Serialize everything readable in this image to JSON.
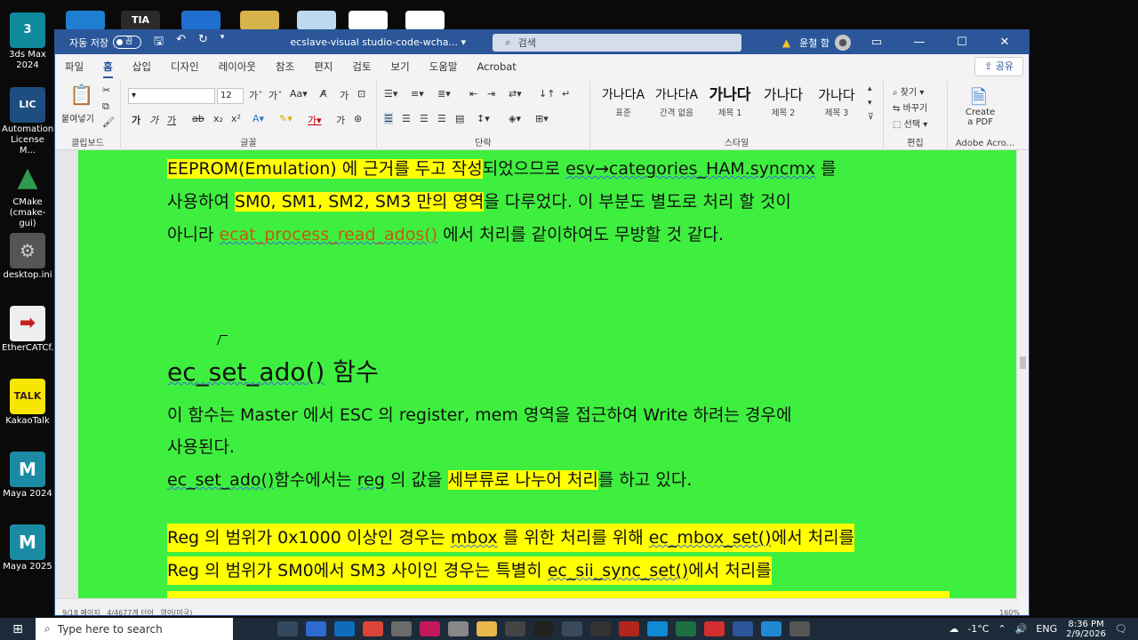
{
  "desktop": {
    "icons": [
      {
        "label": "3ds Max 2024",
        "glyph": "3\nMAX",
        "color": "#0e8a9c"
      },
      {
        "label": "Automation License M...",
        "glyph": "LICEN\nMA",
        "color": "#1e4e80"
      },
      {
        "label": "CMake (cmake-gui)",
        "glyph": "▲",
        "color": "#2f4fa0"
      },
      {
        "label": "desktop.ini",
        "glyph": "⚙",
        "color": "#666666"
      },
      {
        "label": "EtherCATCf...",
        "glyph": "➡",
        "color": "#c62020"
      },
      {
        "label": "KakaoTalk",
        "glyph": "TALK",
        "color": "#f7e600"
      },
      {
        "label": "Maya 2024",
        "glyph": "M",
        "color": "#1a8ba3"
      },
      {
        "label": "Maya 2025",
        "glyph": "M",
        "color": "#1a8ba3"
      }
    ],
    "top_icons": [
      "TIA"
    ]
  },
  "titlebar": {
    "autosave_label": "자동 저장",
    "autosave_state": "끔",
    "doc_name": "ecslave-visual studio-code-wcha...",
    "search_placeholder": "검색",
    "user_name": "윤철 함",
    "minimize": "—",
    "maximize": "☐",
    "close": "✕"
  },
  "tabs": [
    "파일",
    "홈",
    "삽입",
    "디자인",
    "레이아웃",
    "참조",
    "편지",
    "검토",
    "보기",
    "도움말",
    "Acrobat"
  ],
  "active_tab": "홈",
  "share_label": "공유",
  "ribbon": {
    "clipboard": {
      "paste": "붙여넣기",
      "label": "클립보드"
    },
    "font": {
      "size": "12",
      "label": "글꼴",
      "bold": "가",
      "italic": "가",
      "underline": "가"
    },
    "paragraph": {
      "label": "단락"
    },
    "styles": {
      "label": "스타일",
      "items": [
        {
          "sample": "가나다A",
          "name": "표준"
        },
        {
          "sample": "가나다A",
          "name": "간격 없음"
        },
        {
          "sample": "가나다",
          "name": "제목 1"
        },
        {
          "sample": "가나다",
          "name": "제목 2"
        },
        {
          "sample": "가나다",
          "name": "제목 3"
        }
      ]
    },
    "editing": {
      "find": "찾기",
      "replace": "바꾸기",
      "select": "선택",
      "label": "편집"
    },
    "adobe": {
      "create_pdf_1": "Create",
      "create_pdf_2": "a PDF",
      "label": "Adobe Acro..."
    }
  },
  "document": {
    "line1_a": "EEPROM(Emulation) 에 근거를 두고 작성",
    "line1_b": "되었으므로 ",
    "line1_c": "esv→categories_HAM.syncmx",
    "line1_d": " 를",
    "line2_a": "사용하여  ",
    "line2_b": "SM0, SM1, SM2, SM3 만의 영역",
    "line2_c": "을 다루었다.  이 부분도 별도로 처리 할 것이",
    "line3_a": "아니라 ",
    "line3_b": "ecat_process_read_ados()",
    "line3_c": " 에서 처리를 같이하여도 무방할 것 같다.",
    "heading_a": "ec_set_ado()",
    "heading_b": " 함수",
    "para1_line1": " 이 함수는 Master 에서 ESC 의 register, mem 영역을 접근하여 Write 하려는 경우에",
    "para1_line2": "사용된다.",
    "para2_a": "ec_set_ado()",
    "para2_b": "함수에서는  ",
    "para2_c": "reg",
    "para2_d": " 의 값을 ",
    "para2_e": "세부류로 나누어 처리",
    "para2_f": "를 하고 있다.",
    "hl1_a": "Reg 의 범위가 0x1000 이상인 경우는 ",
    "hl1_b": "mbox",
    "hl1_c": " 를 위한 처리를 위해 ",
    "hl1_d": "ec_mbox_set()",
    "hl1_e": "에서 처리를",
    "hl2_a": "Reg 의 범위가 SM0에서 SM3 사이인 경우는 특별히 ",
    "hl2_b": "ec_sii_sync_set()",
    "hl2_c": "에서 처리를"
  },
  "status": {
    "pages": "9/18 페이지",
    "words": "4/4677개 단어",
    "lang": "영어(미국)",
    "zoom": "160%"
  },
  "taskbar": {
    "search_placeholder": "Type here to search",
    "apps": [
      {
        "name": "task-view",
        "color": "#34495e"
      },
      {
        "name": "store",
        "color": "#2e6bd1"
      },
      {
        "name": "outlook",
        "color": "#0f6cbd"
      },
      {
        "name": "chrome",
        "color": "#db4437"
      },
      {
        "name": "app5",
        "color": "#6b6b6b"
      },
      {
        "name": "app6",
        "color": "#c2185b"
      },
      {
        "name": "app7",
        "color": "#888888"
      },
      {
        "name": "explorer",
        "color": "#e8b84a"
      },
      {
        "name": "app9",
        "color": "#444444"
      },
      {
        "name": "terminal",
        "color": "#222222"
      },
      {
        "name": "app11",
        "color": "#3b4a5a"
      },
      {
        "name": "chatgpt",
        "color": "#333333"
      },
      {
        "name": "ssc",
        "color": "#b3261e"
      },
      {
        "name": "edge",
        "color": "#0f8bd6"
      },
      {
        "name": "excel",
        "color": "#1d6f42"
      },
      {
        "name": "acrobat",
        "color": "#d32f2f"
      },
      {
        "name": "word",
        "color": "#2b579a"
      },
      {
        "name": "vscode",
        "color": "#1f8ad2"
      },
      {
        "name": "app19",
        "color": "#555555"
      }
    ],
    "weather": "-1°C",
    "lang": "ENG",
    "time": "8:36 PM",
    "date": "2/9/2026"
  }
}
